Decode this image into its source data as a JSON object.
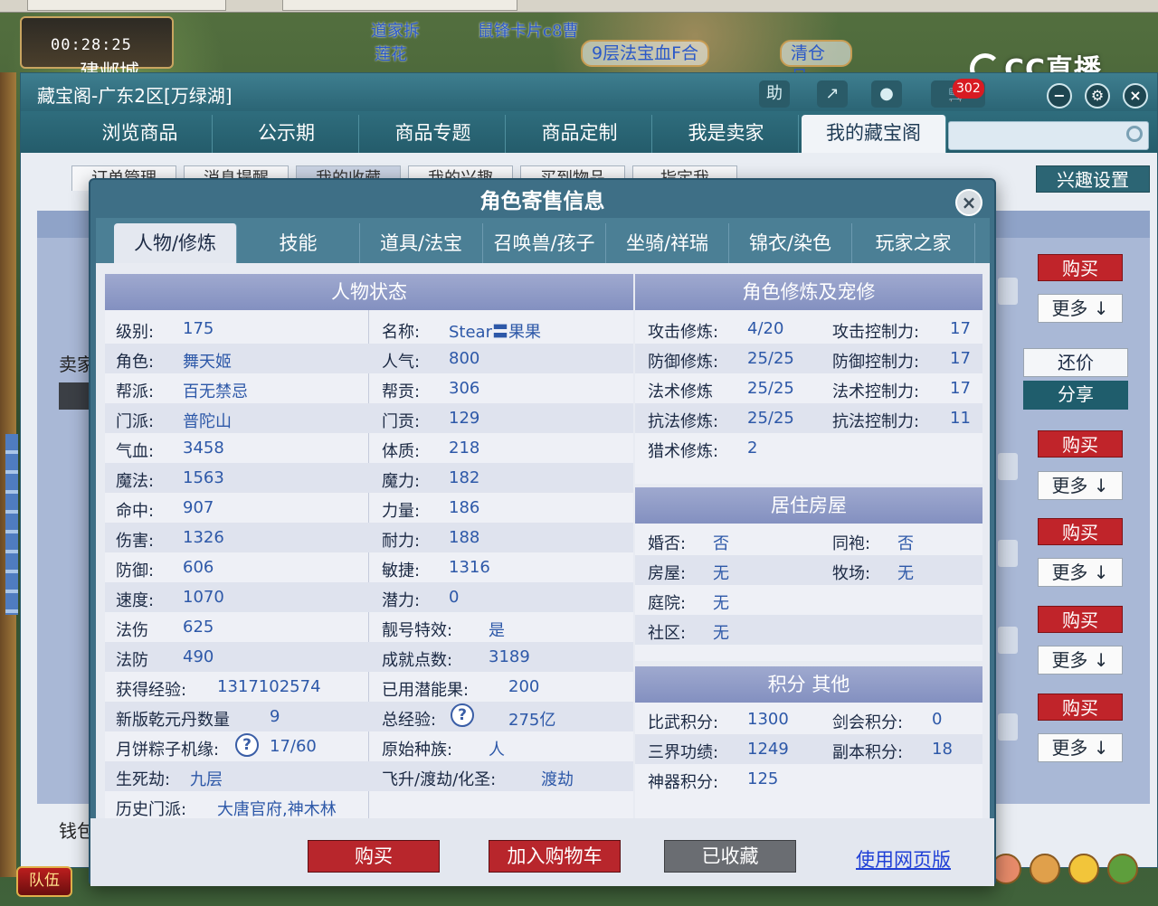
{
  "game_hud": {
    "clock": "00:28:25",
    "city": "建邺城",
    "scroll_1": "道家拆",
    "scroll_2": "鼠锋卡片c8曹",
    "scroll_3": "莲花",
    "scroll_4": "9层法宝血F合",
    "scroll_5": "清仓月",
    "team_button": "队伍",
    "stream_logo": "CC直播"
  },
  "cbg": {
    "title": "藏宝阁-广东2区[万绿湖]",
    "notify_count": "302",
    "nav": [
      {
        "label": "浏览商品"
      },
      {
        "label": "公示期"
      },
      {
        "label": "商品专题"
      },
      {
        "label": "商品定制"
      },
      {
        "label": "我是卖家"
      },
      {
        "label": "我的藏宝阁"
      }
    ],
    "search_placeholder": "",
    "sub_tabs": [
      {
        "label": "订单管理"
      },
      {
        "label": "消息提醒"
      },
      {
        "label": "我的收藏"
      },
      {
        "label": "我的兴趣"
      },
      {
        "label": "买到物品"
      },
      {
        "label": "指定我"
      }
    ],
    "interest_button": "兴趣设置",
    "seller_label": "卖家",
    "money_label": "钱包",
    "side": {
      "buy": "购买",
      "more": "更多",
      "bargain": "还价",
      "share": "分享"
    }
  },
  "modal": {
    "title": "角色寄售信息",
    "tabs": [
      {
        "label": "人物/修炼"
      },
      {
        "label": "技能"
      },
      {
        "label": "道具/法宝"
      },
      {
        "label": "召唤兽/孩子"
      },
      {
        "label": "坐骑/祥瑞"
      },
      {
        "label": "锦衣/染色"
      },
      {
        "label": "玩家之家"
      }
    ],
    "status": {
      "head": "人物状态",
      "level_l": "级别:",
      "level_v": "175",
      "name_l": "名称:",
      "name_v": "Stear〓果果",
      "role_l": "角色:",
      "role_v": "舞天姬",
      "pop_l": "人气:",
      "pop_v": "800",
      "gang_l": "帮派:",
      "gang_v": "百无禁忌",
      "gangc_l": "帮贡:",
      "gangc_v": "306",
      "school_l": "门派:",
      "school_v": "普陀山",
      "schoolc_l": "门贡:",
      "schoolc_v": "129",
      "hp_l": "气血:",
      "hp_v": "3458",
      "con_l": "体质:",
      "con_v": "218",
      "mp_l": "魔法:",
      "mp_v": "1563",
      "mag_l": "魔力:",
      "mag_v": "182",
      "hit_l": "命中:",
      "hit_v": "907",
      "str_l": "力量:",
      "str_v": "186",
      "dmg_l": "伤害:",
      "dmg_v": "1326",
      "end_l": "耐力:",
      "end_v": "188",
      "def_l": "防御:",
      "def_v": "606",
      "agi_l": "敏捷:",
      "agi_v": "1316",
      "spd_l": "速度:",
      "spd_v": "1070",
      "pot_l": "潜力:",
      "pot_v": "0",
      "mdmg_l": "法伤",
      "mdmg_v": "625",
      "title_l": "靓号特效:",
      "title_v": "是",
      "mdef_l": "法防",
      "mdef_v": "490",
      "ach_l": "成就点数:",
      "ach_v": "3189",
      "exp_l": "获得经验:",
      "exp_v": "1317102574",
      "fruit_l": "已用潜能果:",
      "fruit_v": "200",
      "dan_l": "新版乾元丹数量",
      "dan_v": "9",
      "total_l": "总经验:",
      "total_v": "275亿",
      "moon_l": "月饼粽子机缘:",
      "moon_v": "17/60",
      "race_l": "原始种族:",
      "race_v": "人",
      "life_l": "生死劫:",
      "life_v": "九层",
      "fly_l": "飞升/渡劫/化圣:",
      "fly_v": "渡劫",
      "hist_l": "历史门派:",
      "hist_v": "大唐官府,神木林",
      "help_glyph": "?"
    },
    "cult": {
      "head": "角色修炼及宠修",
      "atk_l": "攻击修炼:",
      "atk_v": "4/20",
      "atkc_l": "攻击控制力:",
      "atkc_v": "17",
      "dfn_l": "防御修炼:",
      "dfn_v": "25/25",
      "dfnc_l": "防御控制力:",
      "dfnc_v": "17",
      "spl_l": "法术修炼",
      "spl_v": "25/25",
      "splc_l": "法术控制力:",
      "splc_v": "17",
      "res_l": "抗法修炼:",
      "res_v": "25/25",
      "resc_l": "抗法控制力:",
      "resc_v": "11",
      "hunt_l": "猎术修炼:",
      "hunt_v": "2"
    },
    "house": {
      "head": "居住房屋",
      "marry_l": "婚否:",
      "marry_v": "否",
      "robe_l": "同袍:",
      "robe_v": "否",
      "home_l": "房屋:",
      "home_v": "无",
      "ranch_l": "牧场:",
      "ranch_v": "无",
      "yard_l": "庭院:",
      "yard_v": "无",
      "comm_l": "社区:",
      "comm_v": "无"
    },
    "score": {
      "head": "积分 其他",
      "arena_l": "比武积分:",
      "arena_v": "1300",
      "sword_l": "剑会积分:",
      "sword_v": "0",
      "merit_l": "三界功绩:",
      "merit_v": "1249",
      "dung_l": "副本积分:",
      "dung_v": "18",
      "god_l": "神器积分:",
      "god_v": "125"
    },
    "footer": {
      "buy": "购买",
      "cart": "加入购物车",
      "fav": "已收藏",
      "web": "使用网页版"
    }
  }
}
